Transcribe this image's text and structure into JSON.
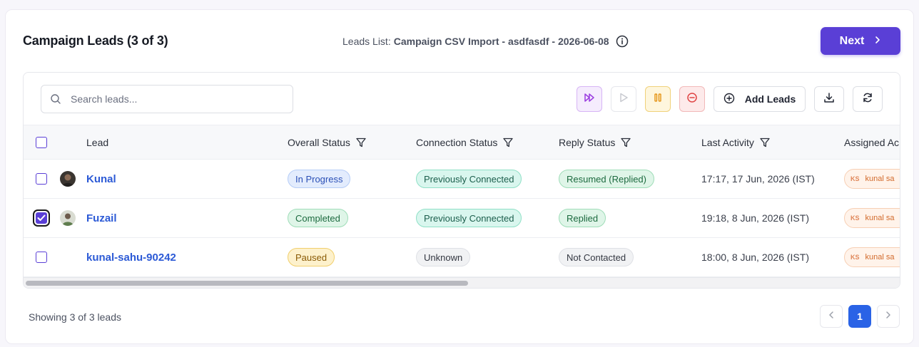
{
  "header": {
    "title": "Campaign Leads (3 of 3)",
    "leads_list_label": "Leads List:",
    "leads_list_value": "Campaign CSV Import - asdfasdf - 2026-06-08",
    "next_label": "Next"
  },
  "toolbar": {
    "search_placeholder": "Search leads...",
    "add_leads_label": "Add Leads",
    "icons": [
      "fast-forward-icon",
      "play-icon",
      "pause-icon",
      "stop-icon",
      "plus-circle-icon",
      "download-icon",
      "refresh-icon"
    ]
  },
  "table": {
    "columns": {
      "lead": "Lead",
      "overall_status": "Overall Status",
      "connection_status": "Connection Status",
      "reply_status": "Reply Status",
      "last_activity": "Last Activity",
      "assigned": "Assigned Ac"
    },
    "rows": [
      {
        "name": "Kunal",
        "overall": "In Progress",
        "connection": "Previously Connected",
        "reply": "Resumed (Replied)",
        "activity": "17:17, 17 Jun, 2026 (IST)",
        "assignee_initials": "KS",
        "assignee_name": "kunal sa",
        "checked": false
      },
      {
        "name": "Fuzail",
        "overall": "Completed",
        "connection": "Previously Connected",
        "reply": "Replied",
        "activity": "19:18, 8 Jun, 2026 (IST)",
        "assignee_initials": "KS",
        "assignee_name": "kunal sa",
        "checked": true
      },
      {
        "name": "kunal-sahu-90242",
        "overall": "Paused",
        "connection": "Unknown",
        "reply": "Not Contacted",
        "activity": "18:00, 8 Jun, 2026 (IST)",
        "assignee_initials": "KS",
        "assignee_name": "kunal sa",
        "checked": false
      }
    ]
  },
  "footer": {
    "showing": "Showing 3 of 3 leads",
    "current_page": "1"
  },
  "colors": {
    "accent": "#5a3fd6",
    "link": "#2c5ad6",
    "page_active": "#2a63e6"
  }
}
